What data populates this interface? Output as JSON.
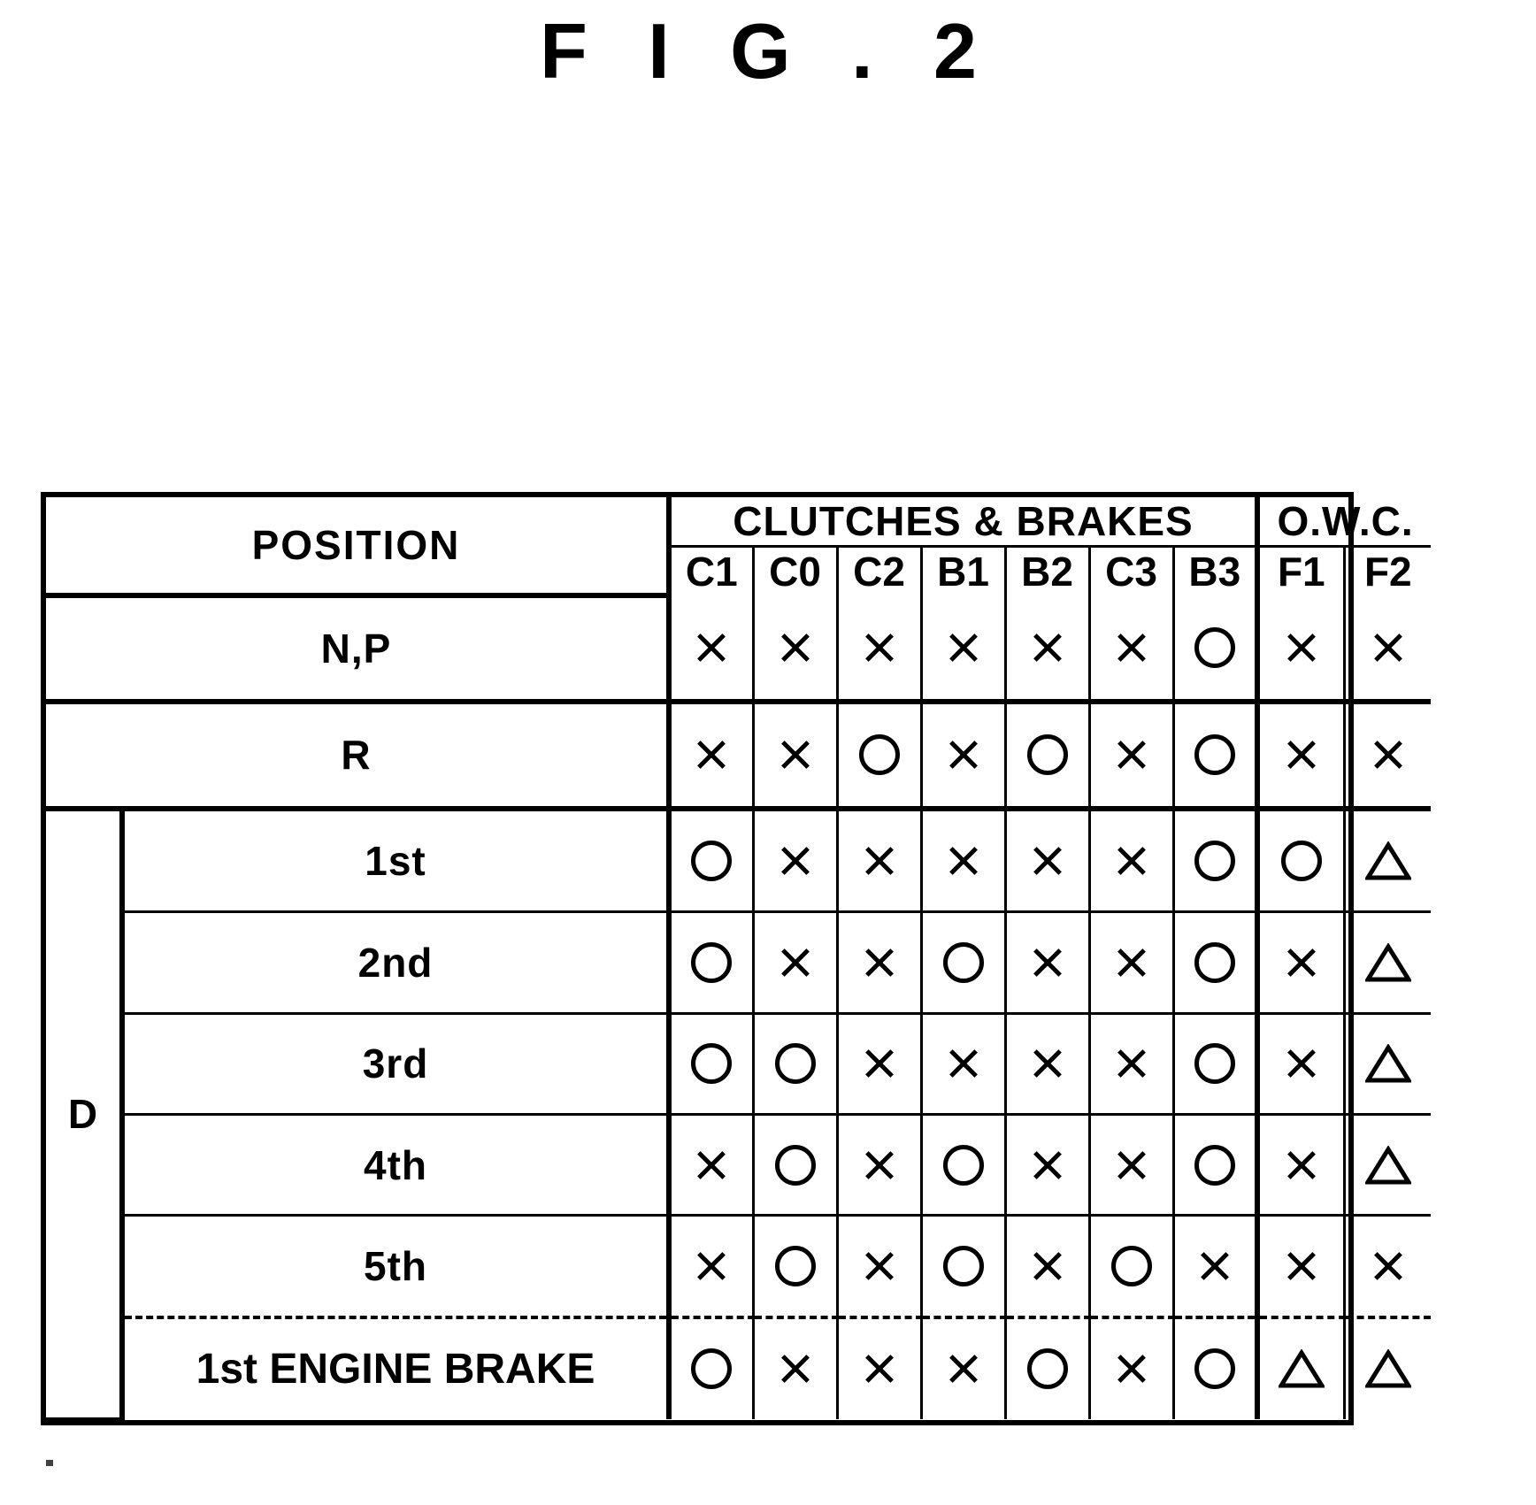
{
  "figure": {
    "title": "F I G . 2"
  },
  "table": {
    "position_header": "POSITION",
    "group_headers": {
      "clutches_brakes": "CLUTCHES & BRAKES",
      "owc": "O.W.C."
    },
    "columns": [
      "C1",
      "C0",
      "C2",
      "B1",
      "B2",
      "C3",
      "B3",
      "F1",
      "F2"
    ],
    "drive_group_label": "D",
    "symbols": {
      "engaged": "circle",
      "released": "cross",
      "partial": "triangle"
    },
    "rows": [
      {
        "label": "N,P",
        "group": null,
        "values": [
          "cross",
          "cross",
          "cross",
          "cross",
          "cross",
          "cross",
          "circle",
          "cross",
          "cross"
        ]
      },
      {
        "label": "R",
        "group": null,
        "values": [
          "cross",
          "cross",
          "circle",
          "cross",
          "circle",
          "cross",
          "circle",
          "cross",
          "cross"
        ]
      },
      {
        "label": "1st",
        "group": "D",
        "values": [
          "circle",
          "cross",
          "cross",
          "cross",
          "cross",
          "cross",
          "circle",
          "circle",
          "triangle"
        ]
      },
      {
        "label": "2nd",
        "group": "D",
        "values": [
          "circle",
          "cross",
          "cross",
          "circle",
          "cross",
          "cross",
          "circle",
          "cross",
          "triangle"
        ]
      },
      {
        "label": "3rd",
        "group": "D",
        "values": [
          "circle",
          "circle",
          "cross",
          "cross",
          "cross",
          "cross",
          "circle",
          "cross",
          "triangle"
        ]
      },
      {
        "label": "4th",
        "group": "D",
        "values": [
          "cross",
          "circle",
          "cross",
          "circle",
          "cross",
          "cross",
          "circle",
          "cross",
          "triangle"
        ]
      },
      {
        "label": "5th",
        "group": "D",
        "values": [
          "cross",
          "circle",
          "cross",
          "circle",
          "cross",
          "circle",
          "cross",
          "cross",
          "cross"
        ]
      },
      {
        "label": "1st ENGINE BRAKE",
        "group": "D",
        "values": [
          "circle",
          "cross",
          "cross",
          "cross",
          "circle",
          "cross",
          "circle",
          "triangle",
          "triangle"
        ]
      }
    ]
  },
  "colors": {
    "ink": "#000000",
    "paper": "#ffffff"
  }
}
